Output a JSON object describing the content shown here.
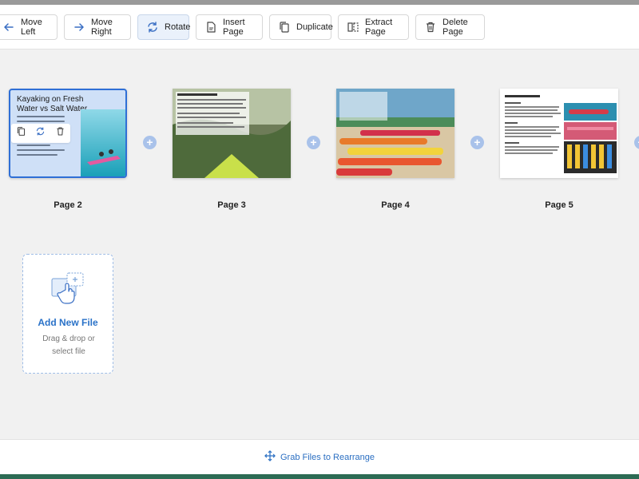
{
  "toolbar": {
    "buttons": [
      {
        "label": "Move Left",
        "icon": "arrow-left-icon"
      },
      {
        "label": "Move Right",
        "icon": "arrow-right-icon"
      },
      {
        "label": "Rotate",
        "icon": "rotate-icon",
        "active": true
      },
      {
        "label": "Insert Page",
        "icon": "insert-page-icon"
      },
      {
        "label": "Duplicate",
        "icon": "duplicate-icon"
      },
      {
        "label": "Extract Page",
        "icon": "extract-page-icon"
      },
      {
        "label": "Delete Page",
        "icon": "trash-icon"
      }
    ]
  },
  "pages": [
    {
      "label": "Page 2",
      "selected": true,
      "title": "Kayaking on Fresh Water vs Salt Water"
    },
    {
      "label": "Page 3",
      "selected": false
    },
    {
      "label": "Page 4",
      "selected": false
    },
    {
      "label": "Page 5",
      "selected": false
    }
  ],
  "dropzone": {
    "title": "Add New File",
    "subtitle": "Drag & drop or select file"
  },
  "bottombar": {
    "label": "Grab Files to Rearrange"
  },
  "colors": {
    "accent": "#2f6fd6",
    "link": "#2a72c8",
    "selection_bg": "#cfe0f7"
  }
}
